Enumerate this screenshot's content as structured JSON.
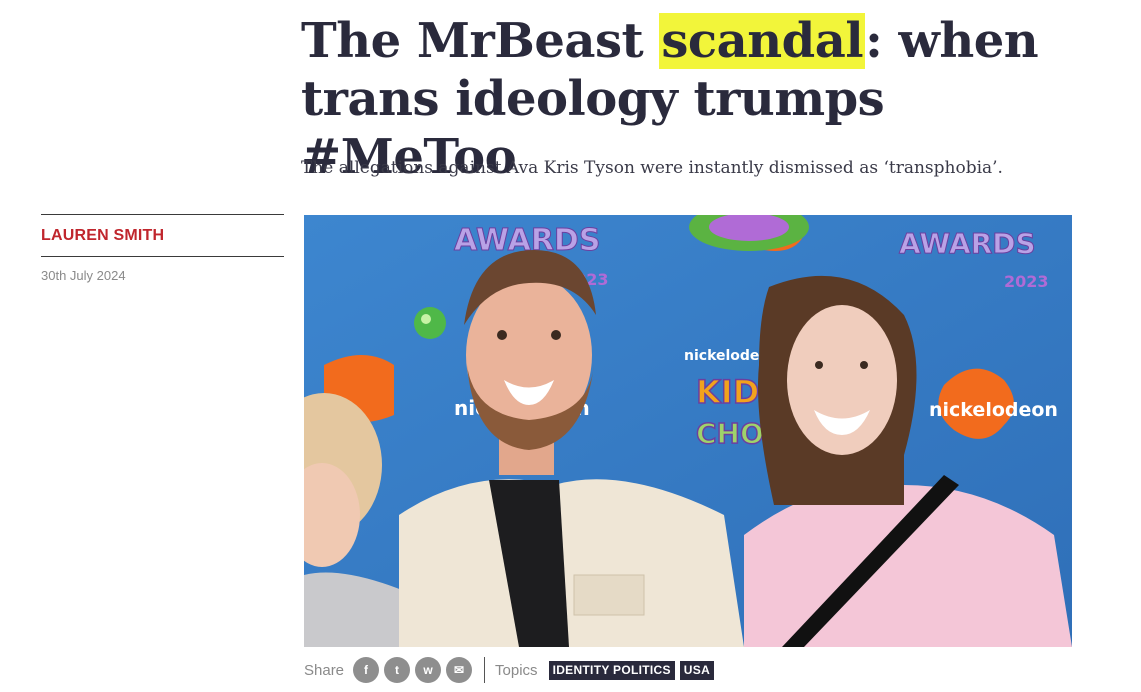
{
  "article": {
    "headline_pre": "The MrBeast ",
    "headline_highlight": "scandal",
    "headline_post": ": when trans ideology trumps #MeToo",
    "standfirst": "The allegations against Ava Kris Tyson were instantly dismissed as ‘transphobia’.",
    "author": "LAUREN SMITH",
    "date": "30th July 2024",
    "highlight_color": "#f2f53a",
    "author_color": "#c0262d"
  },
  "hero": {
    "backdrop_text_left": "AWARDS",
    "backdrop_text_right": "AWARDS",
    "backdrop_brand_1": "nickelodeon",
    "backdrop_brand_2": "nickelodeon",
    "backdrop_brand_3": "nickelodeon",
    "backdrop_kids": "KIDS",
    "backdrop_choice": "CHOICE",
    "backdrop_year_left": "2023",
    "backdrop_year_right": "2023"
  },
  "share": {
    "label": "Share",
    "buttons": [
      {
        "name": "facebook",
        "glyph": "f"
      },
      {
        "name": "twitter",
        "glyph": "t"
      },
      {
        "name": "whatsapp",
        "glyph": "w"
      },
      {
        "name": "email",
        "glyph": "✉"
      }
    ]
  },
  "topics": {
    "label": "Topics",
    "tags": [
      "IDENTITY POLITICS",
      "USA"
    ]
  }
}
